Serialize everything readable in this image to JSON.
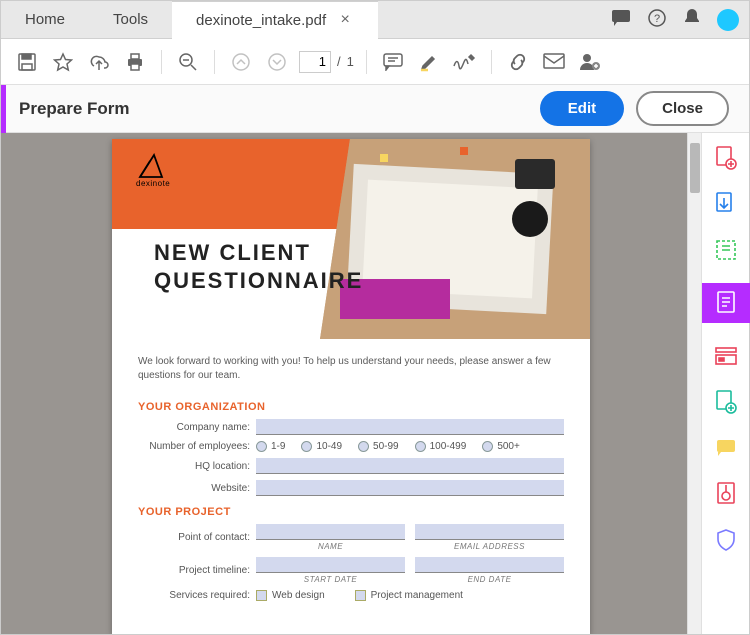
{
  "tabs": {
    "home": "Home",
    "tools": "Tools",
    "file": "dexinote_intake.pdf"
  },
  "page": {
    "current": "1",
    "sep": "/",
    "total": "1"
  },
  "actionbar": {
    "title": "Prepare Form",
    "edit": "Edit",
    "close": "Close"
  },
  "doc": {
    "brand": "dexinote",
    "title_line1": "NEW CLIENT",
    "title_line2": "QUESTIONNAIRE",
    "intro": "We look forward to working with you! To help us understand your needs, please answer a few questions for our team.",
    "sect_org": "YOUR ORGANIZATION",
    "company": "Company name:",
    "num_emp": "Number of employees:",
    "emp_opts": [
      "1-9",
      "10-49",
      "50-99",
      "100-499",
      "500+"
    ],
    "hq": "HQ location:",
    "website": "Website:",
    "sect_proj": "YOUR PROJECT",
    "poc": "Point of contact:",
    "poc_sub1": "NAME",
    "poc_sub2": "EMAIL ADDRESS",
    "timeline": "Project timeline:",
    "tl_sub1": "START DATE",
    "tl_sub2": "END DATE",
    "services": "Services required:",
    "svc_opts": [
      "Web design",
      "Project management"
    ]
  }
}
